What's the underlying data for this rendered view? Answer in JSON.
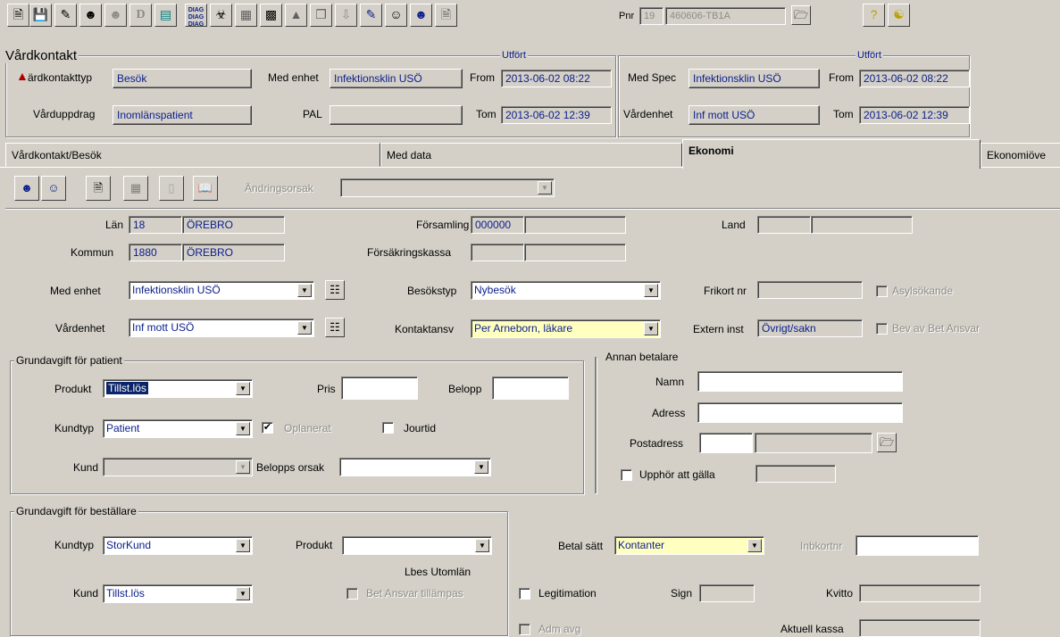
{
  "toolbar": {
    "icons": [
      "new-document-icon",
      "save-icon",
      "edit-icon",
      "person-icon",
      "person-disabled-icon",
      "drg-icon",
      "monitor-icon",
      "diag-icon",
      "diag-person-icon",
      "card-icon",
      "grid-icon",
      "chart-icon",
      "copy-icon",
      "arrow-down-icon",
      "notepad-icon",
      "face-icon",
      "smiley-icon",
      "document-search-icon",
      "question-icon",
      "handshake-icon"
    ],
    "drg_label": "D",
    "diag_label": "DIAG",
    "pnr_label": "Pnr",
    "pnr_prefix": "19",
    "pnr_value": "460606-TB1A"
  },
  "vardkontakt": {
    "title": "Vårdkontakt",
    "utfort_left": "Utfört",
    "utfort_right": "Utfört",
    "kontakttyp_label": "ärdkontakttyp",
    "kontakttyp_value": "Besök",
    "vardupdrag_label": "Vårduppdrag",
    "vardupdrag_value": "Inomlänspatient",
    "med_enhet_label": "Med enhet",
    "med_enhet_value": "Infektionsklin USÖ",
    "pal_label": "PAL",
    "pal_value": "",
    "from_label": "From",
    "from_value": "2013-06-02 08:22",
    "tom_label": "Tom",
    "tom_value": "2013-06-02 12:39",
    "med_spec_label": "Med Spec",
    "med_spec_value": "Infektionsklin USÖ",
    "from2_label": "From",
    "from2_value": "2013-06-02 08:22",
    "vardenhet_label": "Vårdenhet",
    "vardenhet_value": "Inf mott USÖ",
    "tom2_label": "Tom",
    "tom2_value": "2013-06-02 12:39"
  },
  "tabs": [
    {
      "label": "Vårdkontakt/Besök"
    },
    {
      "label": "Med data"
    },
    {
      "label": "Ekonomi"
    },
    {
      "label": "Ekonomiöve"
    }
  ],
  "ekonomi": {
    "andringsorsak_label": "Ändringsorsak",
    "lan_label": "Län",
    "lan_code": "18",
    "lan_name": "ÖREBRO",
    "kommun_label": "Kommun",
    "kommun_code": "1880",
    "kommun_name": "ÖREBRO",
    "forsamling_label": "Församling",
    "forsamling_value": "000000",
    "forsakringskassa_label": "Försäkringskassa",
    "land_label": "Land",
    "med_enhet_label": "Med enhet",
    "med_enhet_value": "Infektionsklin USÖ",
    "vardenhet_label": "Vårdenhet",
    "vardenhet_value": "Inf mott USÖ",
    "besokstyp_label": "Besökstyp",
    "besokstyp_value": "Nybesök",
    "kontaktansv_label": "Kontaktansv",
    "kontaktansv_value": "Per Arneborn, läkare",
    "frikort_label": "Frikort nr",
    "extern_label": "Extern inst",
    "extern_value": "Övrigt/sakn",
    "asylsokande_label": "Asylsökande",
    "bev_label": "Bev av Bet Ansvar"
  },
  "grundavgift_patient": {
    "title": "Grundavgift för patient",
    "produkt_label": "Produkt",
    "produkt_value": "Tillst.lös",
    "pris_label": "Pris",
    "belopp_label": "Belopp",
    "kundtyp_label": "Kundtyp",
    "kundtyp_value": "Patient",
    "oplanerat_label": "Oplanerat",
    "jourtid_label": "Jourtid",
    "kund_label": "Kund",
    "belopps_orsak_label": "Belopps orsak"
  },
  "annan_betalare": {
    "title": "Annan betalare",
    "namn_label": "Namn",
    "adress_label": "Adress",
    "postadress_label": "Postadress",
    "upphor_label": "Upphör att gälla"
  },
  "grundavgift_bestallare": {
    "title": "Grundavgift för beställare",
    "kundtyp_label": "Kundtyp",
    "kundtyp_value": "StorKund",
    "produkt_label": "Produkt",
    "lbes_label": "Lbes Utomlän",
    "kund_label": "Kund",
    "kund_value": "Tillst.lös",
    "bet_ansvar_label": "Bet Ansvar tillämpas",
    "betal_satt_label": "Betal sätt",
    "betal_satt_value": "Kontanter",
    "inbkortnr_label": "Inbkortnr",
    "legitimation_label": "Legitimation",
    "sign_label": "Sign",
    "kvitto_label": "Kvitto",
    "adm_label": "Adm avg",
    "aktuell_kassa_label": "Aktuell kassa"
  }
}
